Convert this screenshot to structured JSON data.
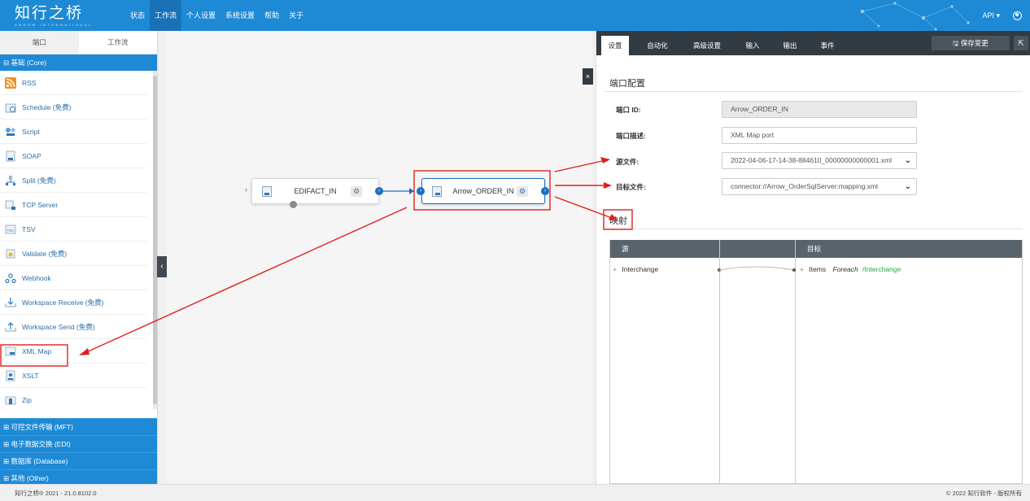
{
  "app": {
    "logo": "知行之桥",
    "logo_sub": "ARROW INTERNATIONAL",
    "nav": [
      {
        "label": "状态",
        "active": false
      },
      {
        "label": "工作流",
        "active": true
      },
      {
        "label": "个人设置",
        "active": false
      },
      {
        "label": "系统设置",
        "active": false
      },
      {
        "label": "帮助",
        "active": false
      },
      {
        "label": "关于",
        "active": false
      }
    ],
    "api_label": "API ▾"
  },
  "sidebar": {
    "tabs": [
      {
        "label": "端口",
        "active": true
      },
      {
        "label": "工作流",
        "active": false
      }
    ],
    "group_core": "⊟ 基础 (Core)",
    "items": [
      {
        "label": "RSS",
        "icon": "rss-icon"
      },
      {
        "label": "Schedule (免费)",
        "icon": "schedule-icon"
      },
      {
        "label": "Script",
        "icon": "script-icon"
      },
      {
        "label": "SOAP",
        "icon": "soap-icon"
      },
      {
        "label": "Split (免费)",
        "icon": "split-icon"
      },
      {
        "label": "TCP Server",
        "icon": "tcp-server-icon"
      },
      {
        "label": "TSV",
        "icon": "tsv-icon"
      },
      {
        "label": "Validate (免费)",
        "icon": "validate-icon"
      },
      {
        "label": "Webhook",
        "icon": "webhook-icon"
      },
      {
        "label": "Workspace Receive (免费)",
        "icon": "workspace-receive-icon"
      },
      {
        "label": "Workspace Send (免费)",
        "icon": "workspace-send-icon"
      },
      {
        "label": "XML Map",
        "icon": "xml-map-icon"
      },
      {
        "label": "XSLT",
        "icon": "xslt-icon"
      },
      {
        "label": "Zip",
        "icon": "zip-icon"
      }
    ],
    "categories": [
      "⊞ 可控文件传输 (MFT)",
      "⊞ 电子数据交换 (EDI)",
      "⊞ 数据库 (Database)",
      "⊞ 其他 (Other)"
    ]
  },
  "canvas": {
    "nodes": [
      {
        "label": "EDIFACT_IN"
      },
      {
        "label": "Arrow_ORDER_IN"
      }
    ]
  },
  "panel": {
    "tabs": [
      {
        "label": "设置",
        "active": true
      },
      {
        "label": "自动化",
        "active": false
      },
      {
        "label": "高级设置",
        "active": false
      },
      {
        "label": "输入",
        "active": false
      },
      {
        "label": "输出",
        "active": false
      },
      {
        "label": "事件",
        "active": false
      }
    ],
    "save_label": "🖫 保存变更",
    "close": "×",
    "section_title": "端口配置",
    "fields": {
      "port_id_label": "端口 ID:",
      "port_id_value": "Arrow_ORDER_IN",
      "desc_label": "端口描述:",
      "desc_value": "XML Map port",
      "source_label": "源文件:",
      "source_value": "2022-04-06-17-14-38-884610_00000000000001.xml",
      "target_label": "目标文件:",
      "target_value": "connector://Arrow_OrderSqlServer:mapping.xml"
    },
    "mapping_title": "映射",
    "mapping": {
      "source_header": "源",
      "target_header": "目标",
      "source_root": "Interchange",
      "target_item": "Items",
      "foreach": "Foreach",
      "foreach_path": "/Interchange"
    }
  },
  "status": {
    "left": "知行之桥® 2021 - 21.0.8102.0",
    "right": "© 2022 知行软件 - 版权所有"
  },
  "colors": {
    "topbar": "#1e8ad6",
    "panel_header": "#333b42",
    "annotation": "#e0201c",
    "foreach_green": "#27a845"
  }
}
